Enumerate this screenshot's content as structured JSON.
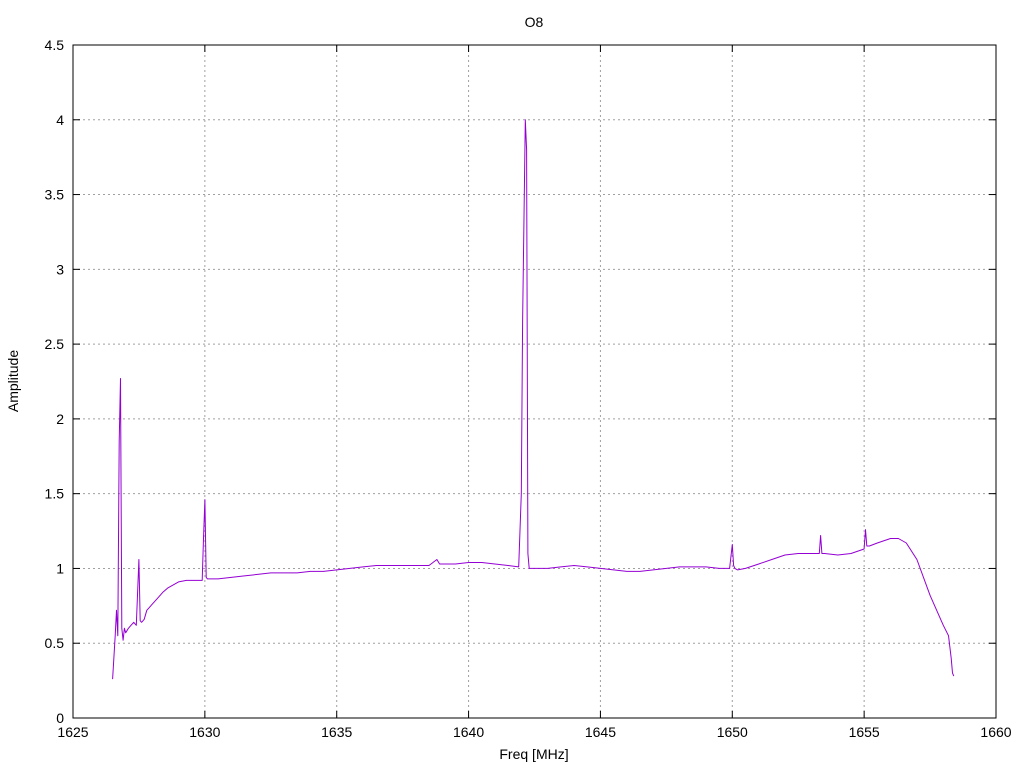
{
  "chart_data": {
    "type": "line",
    "title": "O8",
    "xlabel": "Freq [MHz]",
    "ylabel": "Amplitude",
    "xlim": [
      1625,
      1660
    ],
    "ylim": [
      0,
      4.5
    ],
    "xticks": [
      1625,
      1630,
      1635,
      1640,
      1645,
      1650,
      1655,
      1660
    ],
    "yticks": [
      0,
      0.5,
      1,
      1.5,
      2,
      2.5,
      3,
      3.5,
      4,
      4.5
    ],
    "xtick_labels": [
      "1625",
      "1630",
      "1635",
      "1640",
      "1645",
      "1650",
      "1655",
      "1660"
    ],
    "ytick_labels": [
      "0",
      "0.5",
      "1",
      "1.5",
      "2",
      "2.5",
      "3",
      "3.5",
      "4",
      "4.5"
    ],
    "grid": true,
    "legend": "none",
    "series_color": "#9400d3",
    "series": [
      {
        "x": [
          1626.5,
          1626.6,
          1626.65,
          1626.7,
          1626.75,
          1626.8,
          1626.85,
          1626.9,
          1626.95,
          1627.0,
          1627.1,
          1627.2,
          1627.3,
          1627.4,
          1627.5,
          1627.55,
          1627.6,
          1627.7,
          1627.8,
          1627.9,
          1628.0,
          1628.2,
          1628.4,
          1628.6,
          1628.8,
          1629.0,
          1629.3,
          1629.6,
          1629.9,
          1629.95,
          1630.0,
          1630.05,
          1630.1,
          1630.5,
          1631.0,
          1631.5,
          1632.0,
          1632.5,
          1633.0,
          1633.5,
          1634.0,
          1634.5,
          1635.0,
          1635.5,
          1636.0,
          1636.5,
          1637.0,
          1637.5,
          1638.0,
          1638.5,
          1638.8,
          1638.9,
          1639.0,
          1639.5,
          1640.0,
          1640.5,
          1641.0,
          1641.5,
          1641.9,
          1642.0,
          1642.05,
          1642.1,
          1642.15,
          1642.2,
          1642.25,
          1642.3,
          1642.35,
          1642.4,
          1643.0,
          1643.5,
          1644.0,
          1644.5,
          1645.0,
          1645.5,
          1646.0,
          1646.5,
          1647.0,
          1647.5,
          1648.0,
          1648.5,
          1649.0,
          1649.5,
          1649.9,
          1650.0,
          1650.05,
          1650.1,
          1650.2,
          1650.5,
          1651.0,
          1651.5,
          1652.0,
          1652.5,
          1653.0,
          1653.3,
          1653.35,
          1653.4,
          1653.5,
          1654.0,
          1654.5,
          1655.0,
          1655.05,
          1655.1,
          1655.2,
          1655.5,
          1656.0,
          1656.3,
          1656.6,
          1657.0,
          1657.5,
          1658.0,
          1658.2,
          1658.3,
          1658.35,
          1658.4
        ],
        "y": [
          0.26,
          0.55,
          0.72,
          0.55,
          1.85,
          2.27,
          0.6,
          0.52,
          0.6,
          0.57,
          0.6,
          0.62,
          0.64,
          0.62,
          1.06,
          0.65,
          0.64,
          0.66,
          0.72,
          0.74,
          0.76,
          0.8,
          0.84,
          0.87,
          0.89,
          0.91,
          0.92,
          0.92,
          0.92,
          1.2,
          1.46,
          0.94,
          0.93,
          0.93,
          0.94,
          0.95,
          0.96,
          0.97,
          0.97,
          0.97,
          0.98,
          0.98,
          0.99,
          1.0,
          1.01,
          1.02,
          1.02,
          1.02,
          1.02,
          1.02,
          1.06,
          1.03,
          1.03,
          1.03,
          1.04,
          1.04,
          1.03,
          1.02,
          1.01,
          1.5,
          2.65,
          3.35,
          4.0,
          3.8,
          1.1,
          1.0,
          1.0,
          1.0,
          1.0,
          1.01,
          1.02,
          1.01,
          1.0,
          0.99,
          0.98,
          0.98,
          0.99,
          1.0,
          1.01,
          1.01,
          1.01,
          1.0,
          1.0,
          1.16,
          1.02,
          1.0,
          0.99,
          1.0,
          1.03,
          1.06,
          1.09,
          1.1,
          1.1,
          1.1,
          1.22,
          1.1,
          1.1,
          1.09,
          1.1,
          1.13,
          1.26,
          1.15,
          1.15,
          1.17,
          1.2,
          1.2,
          1.17,
          1.06,
          0.82,
          0.62,
          0.55,
          0.4,
          0.3,
          0.28
        ]
      }
    ]
  }
}
